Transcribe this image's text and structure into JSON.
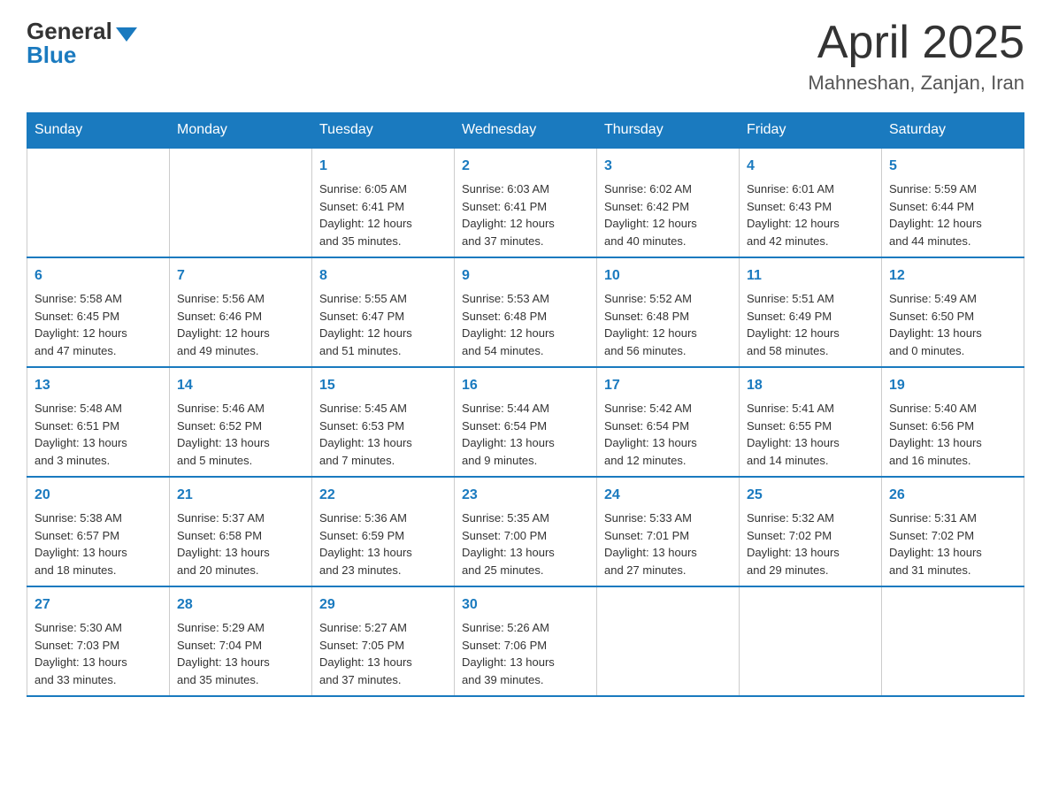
{
  "header": {
    "logo_general": "General",
    "logo_blue": "Blue",
    "month_title": "April 2025",
    "subtitle": "Mahneshan, Zanjan, Iran"
  },
  "weekdays": [
    "Sunday",
    "Monday",
    "Tuesday",
    "Wednesday",
    "Thursday",
    "Friday",
    "Saturday"
  ],
  "weeks": [
    [
      {
        "day": "",
        "info": ""
      },
      {
        "day": "",
        "info": ""
      },
      {
        "day": "1",
        "info": "Sunrise: 6:05 AM\nSunset: 6:41 PM\nDaylight: 12 hours\nand 35 minutes."
      },
      {
        "day": "2",
        "info": "Sunrise: 6:03 AM\nSunset: 6:41 PM\nDaylight: 12 hours\nand 37 minutes."
      },
      {
        "day": "3",
        "info": "Sunrise: 6:02 AM\nSunset: 6:42 PM\nDaylight: 12 hours\nand 40 minutes."
      },
      {
        "day": "4",
        "info": "Sunrise: 6:01 AM\nSunset: 6:43 PM\nDaylight: 12 hours\nand 42 minutes."
      },
      {
        "day": "5",
        "info": "Sunrise: 5:59 AM\nSunset: 6:44 PM\nDaylight: 12 hours\nand 44 minutes."
      }
    ],
    [
      {
        "day": "6",
        "info": "Sunrise: 5:58 AM\nSunset: 6:45 PM\nDaylight: 12 hours\nand 47 minutes."
      },
      {
        "day": "7",
        "info": "Sunrise: 5:56 AM\nSunset: 6:46 PM\nDaylight: 12 hours\nand 49 minutes."
      },
      {
        "day": "8",
        "info": "Sunrise: 5:55 AM\nSunset: 6:47 PM\nDaylight: 12 hours\nand 51 minutes."
      },
      {
        "day": "9",
        "info": "Sunrise: 5:53 AM\nSunset: 6:48 PM\nDaylight: 12 hours\nand 54 minutes."
      },
      {
        "day": "10",
        "info": "Sunrise: 5:52 AM\nSunset: 6:48 PM\nDaylight: 12 hours\nand 56 minutes."
      },
      {
        "day": "11",
        "info": "Sunrise: 5:51 AM\nSunset: 6:49 PM\nDaylight: 12 hours\nand 58 minutes."
      },
      {
        "day": "12",
        "info": "Sunrise: 5:49 AM\nSunset: 6:50 PM\nDaylight: 13 hours\nand 0 minutes."
      }
    ],
    [
      {
        "day": "13",
        "info": "Sunrise: 5:48 AM\nSunset: 6:51 PM\nDaylight: 13 hours\nand 3 minutes."
      },
      {
        "day": "14",
        "info": "Sunrise: 5:46 AM\nSunset: 6:52 PM\nDaylight: 13 hours\nand 5 minutes."
      },
      {
        "day": "15",
        "info": "Sunrise: 5:45 AM\nSunset: 6:53 PM\nDaylight: 13 hours\nand 7 minutes."
      },
      {
        "day": "16",
        "info": "Sunrise: 5:44 AM\nSunset: 6:54 PM\nDaylight: 13 hours\nand 9 minutes."
      },
      {
        "day": "17",
        "info": "Sunrise: 5:42 AM\nSunset: 6:54 PM\nDaylight: 13 hours\nand 12 minutes."
      },
      {
        "day": "18",
        "info": "Sunrise: 5:41 AM\nSunset: 6:55 PM\nDaylight: 13 hours\nand 14 minutes."
      },
      {
        "day": "19",
        "info": "Sunrise: 5:40 AM\nSunset: 6:56 PM\nDaylight: 13 hours\nand 16 minutes."
      }
    ],
    [
      {
        "day": "20",
        "info": "Sunrise: 5:38 AM\nSunset: 6:57 PM\nDaylight: 13 hours\nand 18 minutes."
      },
      {
        "day": "21",
        "info": "Sunrise: 5:37 AM\nSunset: 6:58 PM\nDaylight: 13 hours\nand 20 minutes."
      },
      {
        "day": "22",
        "info": "Sunrise: 5:36 AM\nSunset: 6:59 PM\nDaylight: 13 hours\nand 23 minutes."
      },
      {
        "day": "23",
        "info": "Sunrise: 5:35 AM\nSunset: 7:00 PM\nDaylight: 13 hours\nand 25 minutes."
      },
      {
        "day": "24",
        "info": "Sunrise: 5:33 AM\nSunset: 7:01 PM\nDaylight: 13 hours\nand 27 minutes."
      },
      {
        "day": "25",
        "info": "Sunrise: 5:32 AM\nSunset: 7:02 PM\nDaylight: 13 hours\nand 29 minutes."
      },
      {
        "day": "26",
        "info": "Sunrise: 5:31 AM\nSunset: 7:02 PM\nDaylight: 13 hours\nand 31 minutes."
      }
    ],
    [
      {
        "day": "27",
        "info": "Sunrise: 5:30 AM\nSunset: 7:03 PM\nDaylight: 13 hours\nand 33 minutes."
      },
      {
        "day": "28",
        "info": "Sunrise: 5:29 AM\nSunset: 7:04 PM\nDaylight: 13 hours\nand 35 minutes."
      },
      {
        "day": "29",
        "info": "Sunrise: 5:27 AM\nSunset: 7:05 PM\nDaylight: 13 hours\nand 37 minutes."
      },
      {
        "day": "30",
        "info": "Sunrise: 5:26 AM\nSunset: 7:06 PM\nDaylight: 13 hours\nand 39 minutes."
      },
      {
        "day": "",
        "info": ""
      },
      {
        "day": "",
        "info": ""
      },
      {
        "day": "",
        "info": ""
      }
    ]
  ]
}
